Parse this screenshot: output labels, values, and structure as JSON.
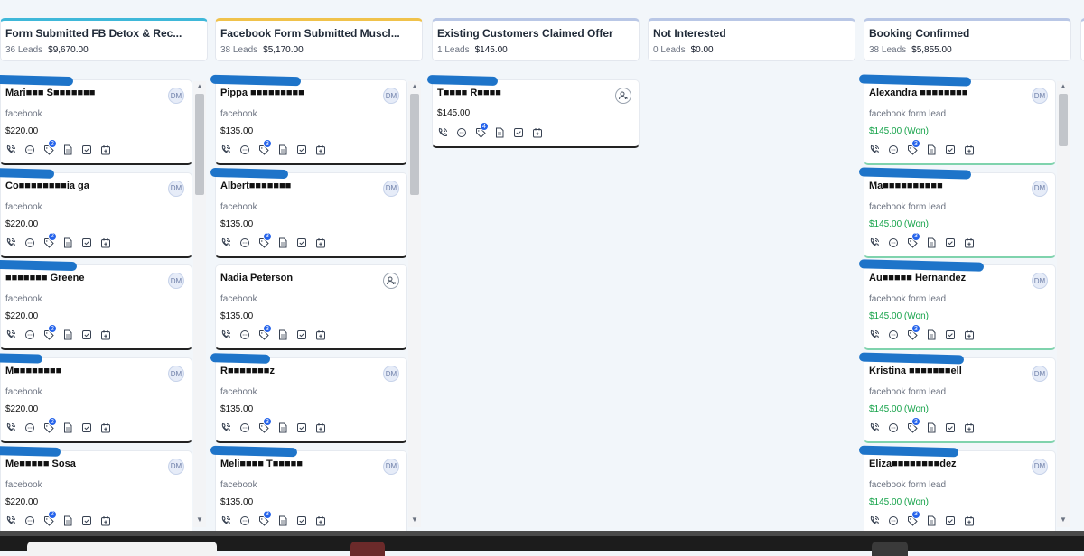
{
  "columns": [
    {
      "title": "Form Submitted FB Detox & Rec...",
      "lead_count": "36 Leads",
      "total": "$9,670.00",
      "accent": "#3fb8d9"
    },
    {
      "title": "Facebook Form Submitted Muscl...",
      "lead_count": "38 Leads",
      "total": "$5,170.00",
      "accent": "#f0c24b"
    },
    {
      "title": "Existing Customers Claimed Offer",
      "lead_count": "1 Leads",
      "total": "$145.00",
      "accent": "#b9c7e6"
    },
    {
      "title": "Not Interested",
      "lead_count": "0 Leads",
      "total": "$0.00",
      "accent": "#b9c7e6"
    },
    {
      "title": "Booking Confirmed",
      "lead_count": "38 Leads",
      "total": "$5,855.00",
      "accent": "#b9c7e6"
    }
  ],
  "cards": [
    [
      {
        "name": "Mari■■■ S■■■■■■■",
        "source": "facebook",
        "value": "$220.00",
        "badge": "2",
        "owner": "DM"
      },
      {
        "name": "Co■■■■■■■■ia ga",
        "source": "facebook",
        "value": "$220.00",
        "badge": "2",
        "owner": "DM"
      },
      {
        "name": "■■■■■■■ Greene",
        "source": "facebook",
        "value": "$220.00",
        "badge": "2",
        "owner": "DM"
      },
      {
        "name": "M■■■■■■■■",
        "source": "facebook",
        "value": "$220.00",
        "badge": "2",
        "owner": "DM"
      },
      {
        "name": "Me■■■■■ Sosa",
        "source": "facebook",
        "value": "$220.00",
        "badge": "2",
        "owner": "DM"
      }
    ],
    [
      {
        "name": "Pippa ■■■■■■■■■",
        "source": "facebook",
        "value": "$135.00",
        "badge": "3",
        "owner": "DM"
      },
      {
        "name": "Albert■■■■■■■",
        "source": "facebook",
        "value": "$135.00",
        "badge": "3",
        "owner": "DM"
      },
      {
        "name": "Nadia Peterson",
        "source": "facebook",
        "value": "$135.00",
        "badge": "3",
        "owner": ""
      },
      {
        "name": "R■■■■■■■z",
        "source": "facebook",
        "value": "$135.00",
        "badge": "3",
        "owner": "DM"
      },
      {
        "name": "Meli■■■■ T■■■■■",
        "source": "facebook",
        "value": "$135.00",
        "badge": "3",
        "owner": "DM"
      }
    ],
    [
      {
        "name": "T■■■■ R■■■■",
        "source": "",
        "value": "$145.00",
        "badge": "4",
        "owner": ""
      }
    ],
    [],
    [
      {
        "name": "Alexandra ■■■■■■■■",
        "source": "facebook form lead",
        "value": "$145.00 (Won)",
        "badge": "3",
        "owner": "DM"
      },
      {
        "name": "Ma■■■■■■■■■■",
        "source": "facebook form lead",
        "value": "$145.00 (Won)",
        "badge": "3",
        "owner": "DM"
      },
      {
        "name": "Au■■■■■ Hernandez",
        "source": "facebook form lead",
        "value": "$145.00 (Won)",
        "badge": "3",
        "owner": "DM"
      },
      {
        "name": "Kristina ■■■■■■■ell",
        "source": "facebook form lead",
        "value": "$145.00 (Won)",
        "badge": "3",
        "owner": "DM"
      },
      {
        "name": "Eliza■■■■■■■■dez",
        "source": "facebook form lead",
        "value": "$145.00 (Won)",
        "badge": "3",
        "owner": "DM"
      }
    ]
  ],
  "card_icons": [
    "phone-icon",
    "chat-icon",
    "tag-icon",
    "document-icon",
    "checkbox-icon",
    "calendar-add-icon"
  ],
  "colors": {
    "won": "#16a34a",
    "badge": "#2563eb",
    "redaction": "#1e74c9"
  }
}
